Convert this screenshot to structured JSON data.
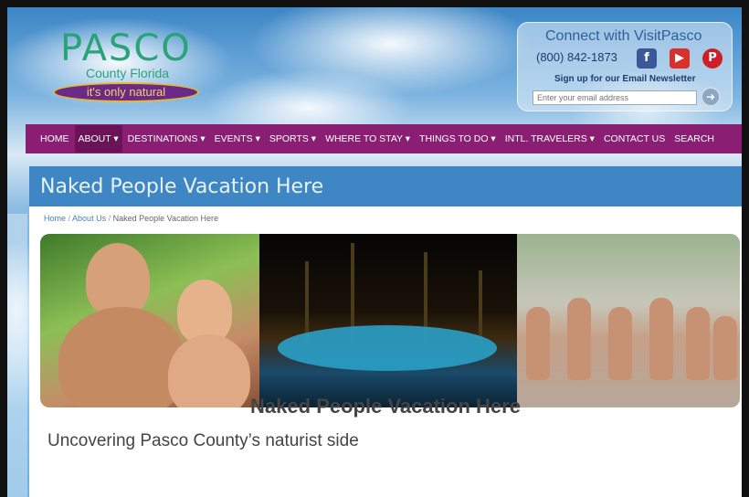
{
  "header": {
    "logo_title": "PASCO",
    "logo_subtitle": "County Florida",
    "logo_tagline": "it's only natural",
    "connect_title": "Connect with VisitPasco",
    "phone": "(800) 842-1873",
    "newsletter_label": "Sign up for our Email Newsletter",
    "email_placeholder": "Enter your email address",
    "social": {
      "facebook": "f",
      "youtube": "▶",
      "pinterest": "P"
    }
  },
  "nav": {
    "items": [
      "HOME",
      "ABOUT ▾",
      "DESTINATIONS ▾",
      "EVENTS ▾",
      "SPORTS ▾",
      "WHERE TO STAY ▾",
      "THINGS TO DO ▾",
      "INTL. TRAVELERS ▾",
      "CONTACT US",
      "SEARCH"
    ],
    "active_index": 1
  },
  "page": {
    "banner_title": "Naked People Vacation Here",
    "breadcrumb": [
      "Home",
      "About Us",
      "Naked People Vacation Here"
    ],
    "heading": "Naked People Vacation Here",
    "subheading": "Uncovering Pasco County’s naturist side"
  },
  "colors": {
    "nav_bg": "#8a1e73",
    "banner_bg": "#3f86c5",
    "logo_green": "#2aa37a"
  }
}
